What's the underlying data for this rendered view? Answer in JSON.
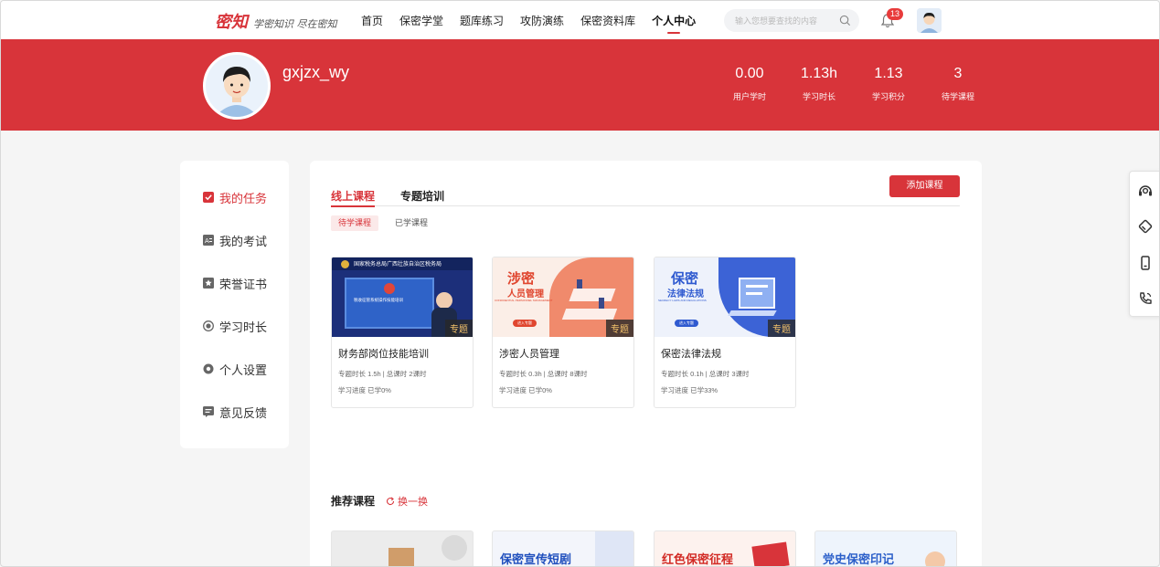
{
  "header": {
    "logo_text": "密知",
    "logo_slogan": "学密知识 尽在密知",
    "nav": [
      {
        "label": "首页"
      },
      {
        "label": "保密学堂"
      },
      {
        "label": "题库练习"
      },
      {
        "label": "攻防演练"
      },
      {
        "label": "保密资料库"
      },
      {
        "label": "个人中心",
        "active": true
      }
    ],
    "search_placeholder": "输入您想要查找的内容",
    "notification_count": "13"
  },
  "profile": {
    "username": "gxjzx_wy",
    "stats": [
      {
        "value": "0.00",
        "label": "用户学时"
      },
      {
        "value": "1.13h",
        "label": "学习时长"
      },
      {
        "value": "1.13",
        "label": "学习积分"
      },
      {
        "value": "3",
        "label": "待学课程"
      }
    ]
  },
  "sidebar": {
    "items": [
      {
        "label": "我的任务",
        "icon": "checkbox-icon",
        "active": true
      },
      {
        "label": "我的考试",
        "icon": "exam-icon"
      },
      {
        "label": "荣誉证书",
        "icon": "certificate-icon"
      },
      {
        "label": "学习时长",
        "icon": "clock-icon"
      },
      {
        "label": "个人设置",
        "icon": "settings-icon"
      },
      {
        "label": "意见反馈",
        "icon": "feedback-icon"
      }
    ]
  },
  "main": {
    "tabs": [
      {
        "label": "线上课程",
        "active": true
      },
      {
        "label": "专题培训"
      }
    ],
    "add_button": "添加课程",
    "subtabs": [
      {
        "label": "待学课程",
        "active": true
      },
      {
        "label": "已学课程"
      }
    ],
    "courses": [
      {
        "title": "财务部岗位技能培训",
        "tag": "专题",
        "meta1": "专题时长 1.5h | 总课时 2课时",
        "meta2": "学习进度 已学0%",
        "thumb_header": "国家税务总局广西壮族自治区税务局",
        "thumb_screen": "税收征管系统操作技能培训"
      },
      {
        "title": "涉密人员管理",
        "tag": "专题",
        "meta1": "专题时长 0.3h | 总课时 8课时",
        "meta2": "学习进度 已学0%",
        "thumb_title": "涉密",
        "thumb_sub": "人员管理",
        "thumb_en": "CONFIDENTIAL PERSONNEL MANAGEMENT",
        "thumb_btn": "进入专题"
      },
      {
        "title": "保密法律法规",
        "tag": "专题",
        "meta1": "专题时长 0.1h | 总课时 3课时",
        "meta2": "学习进度 已学33%",
        "thumb_title": "保密",
        "thumb_sub": "法律法规",
        "thumb_en": "SECRECY LAWS AND REGULATIONS",
        "thumb_btn": "进入专题"
      }
    ],
    "recommend_title": "推荐课程",
    "refresh_label": "换一换",
    "recommended": [
      {
        "text": ""
      },
      {
        "text": "保密宣传短剧"
      },
      {
        "text": "红色保密征程"
      },
      {
        "text": "党史保密印记"
      }
    ]
  },
  "colors": {
    "accent": "#d8343a"
  }
}
